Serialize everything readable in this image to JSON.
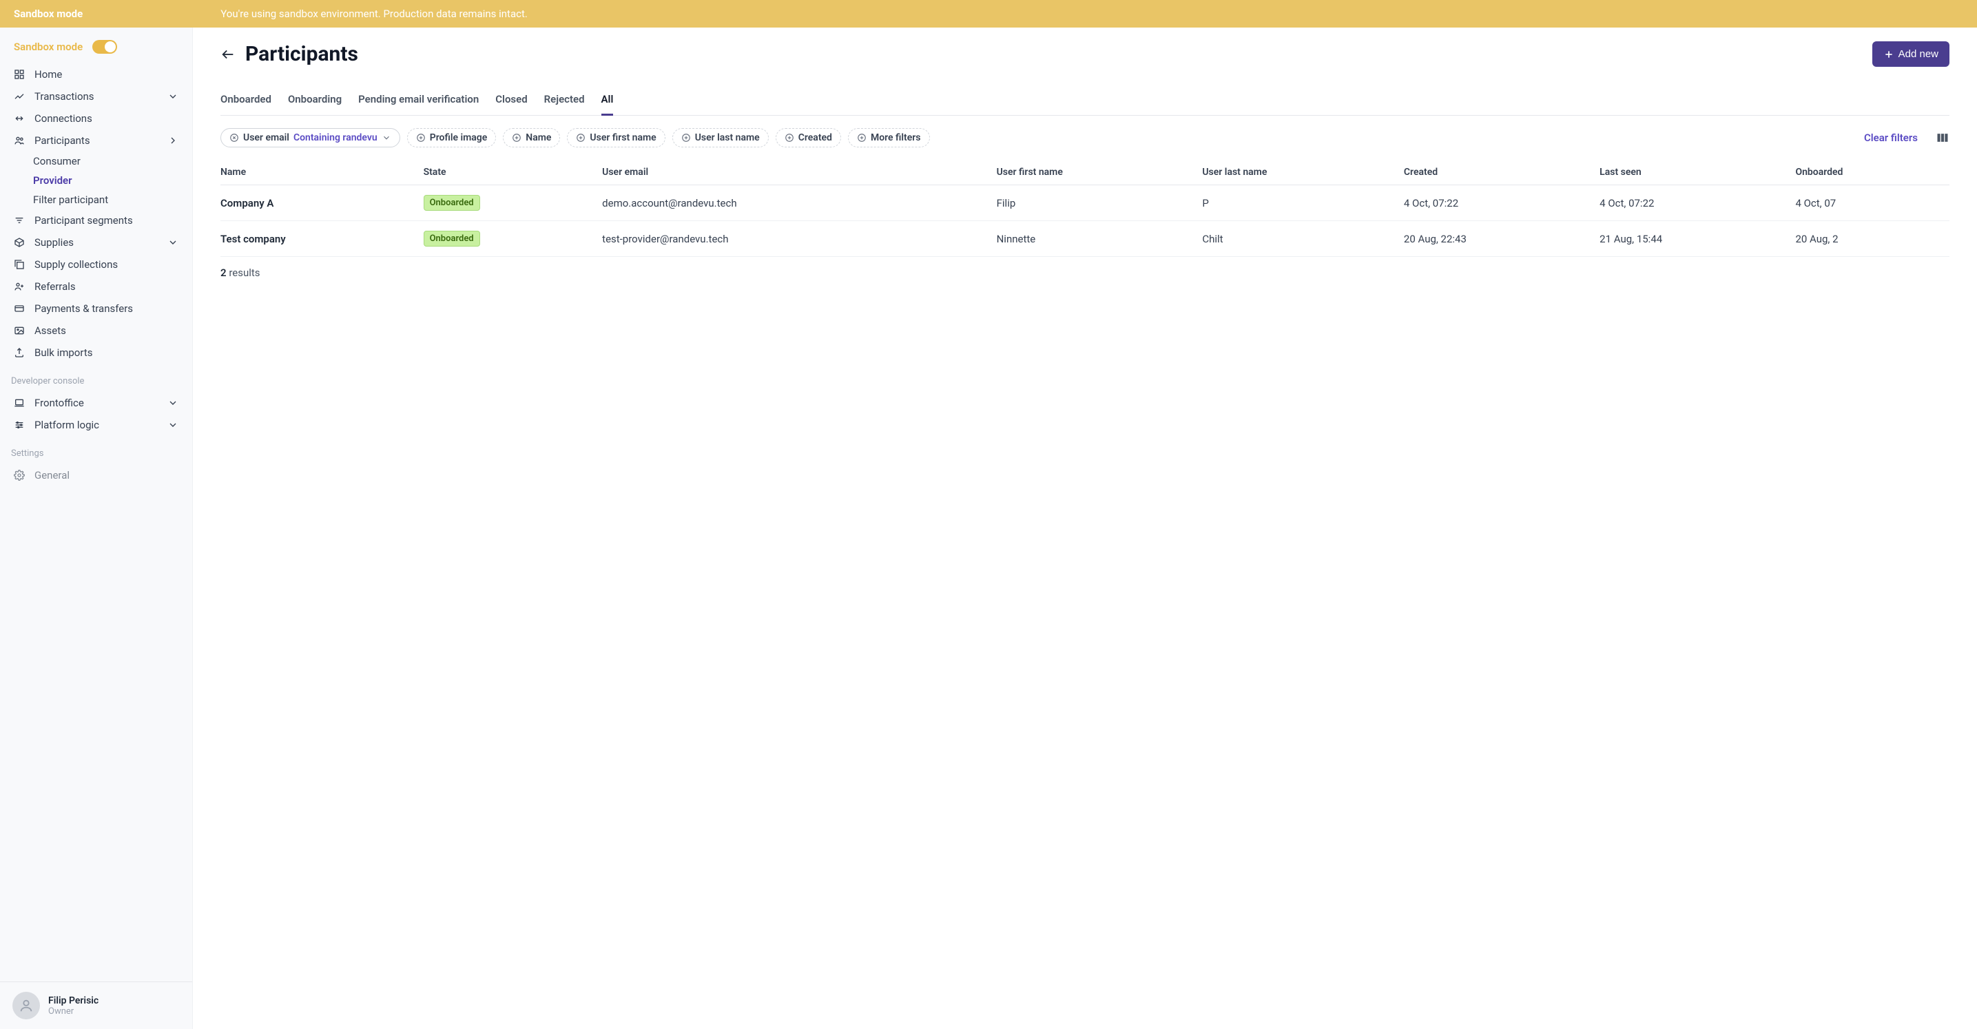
{
  "banner": {
    "title": "Sandbox mode",
    "message": "You're using sandbox environment. Production data remains intact."
  },
  "sidebar": {
    "sandbox_label": "Sandbox mode",
    "nav": {
      "home": "Home",
      "transactions": "Transactions",
      "connections": "Connections",
      "participants": "Participants",
      "participants_sub": {
        "consumer": "Consumer",
        "provider": "Provider",
        "filter_participant": "Filter participant"
      },
      "participant_segments": "Participant segments",
      "supplies": "Supplies",
      "supply_collections": "Supply collections",
      "referrals": "Referrals",
      "payments": "Payments & transfers",
      "assets": "Assets",
      "bulk_imports": "Bulk imports"
    },
    "sections": {
      "developer": "Developer console",
      "settings": "Settings"
    },
    "dev_nav": {
      "frontoffice": "Frontoffice",
      "platform_logic": "Platform logic"
    },
    "settings_nav": {
      "general": "General"
    },
    "user": {
      "name": "Filip Perisic",
      "role": "Owner"
    }
  },
  "header": {
    "title": "Participants",
    "add_btn": "Add new"
  },
  "tabs": {
    "onboarded": "Onboarded",
    "onboarding": "Onboarding",
    "pending": "Pending email verification",
    "closed": "Closed",
    "rejected": "Rejected",
    "all": "All"
  },
  "filters": {
    "user_email_label": "User email",
    "user_email_value": "Containing randevu",
    "profile_image": "Profile image",
    "name": "Name",
    "user_first_name": "User first name",
    "user_last_name": "User last name",
    "created": "Created",
    "more": "More filters",
    "clear": "Clear filters"
  },
  "table": {
    "headers": {
      "name": "Name",
      "state": "State",
      "user_email": "User email",
      "user_first_name": "User first name",
      "user_last_name": "User last name",
      "created": "Created",
      "last_seen": "Last seen",
      "onboarded": "Onboarded"
    },
    "rows": [
      {
        "name": "Company A",
        "state": "Onboarded",
        "user_email": "demo.account@randevu.tech",
        "user_first_name": "Filip",
        "user_last_name": "P",
        "created": "4 Oct, 07:22",
        "last_seen": "4 Oct, 07:22",
        "onboarded": "4 Oct, 07"
      },
      {
        "name": "Test company",
        "state": "Onboarded",
        "user_email": "test-provider@randevu.tech",
        "user_first_name": "Ninnette",
        "user_last_name": "Chilt",
        "created": "20 Aug, 22:43",
        "last_seen": "21 Aug, 15:44",
        "onboarded": "20 Aug, 2"
      }
    ],
    "result_count": "2",
    "result_label": "results"
  }
}
